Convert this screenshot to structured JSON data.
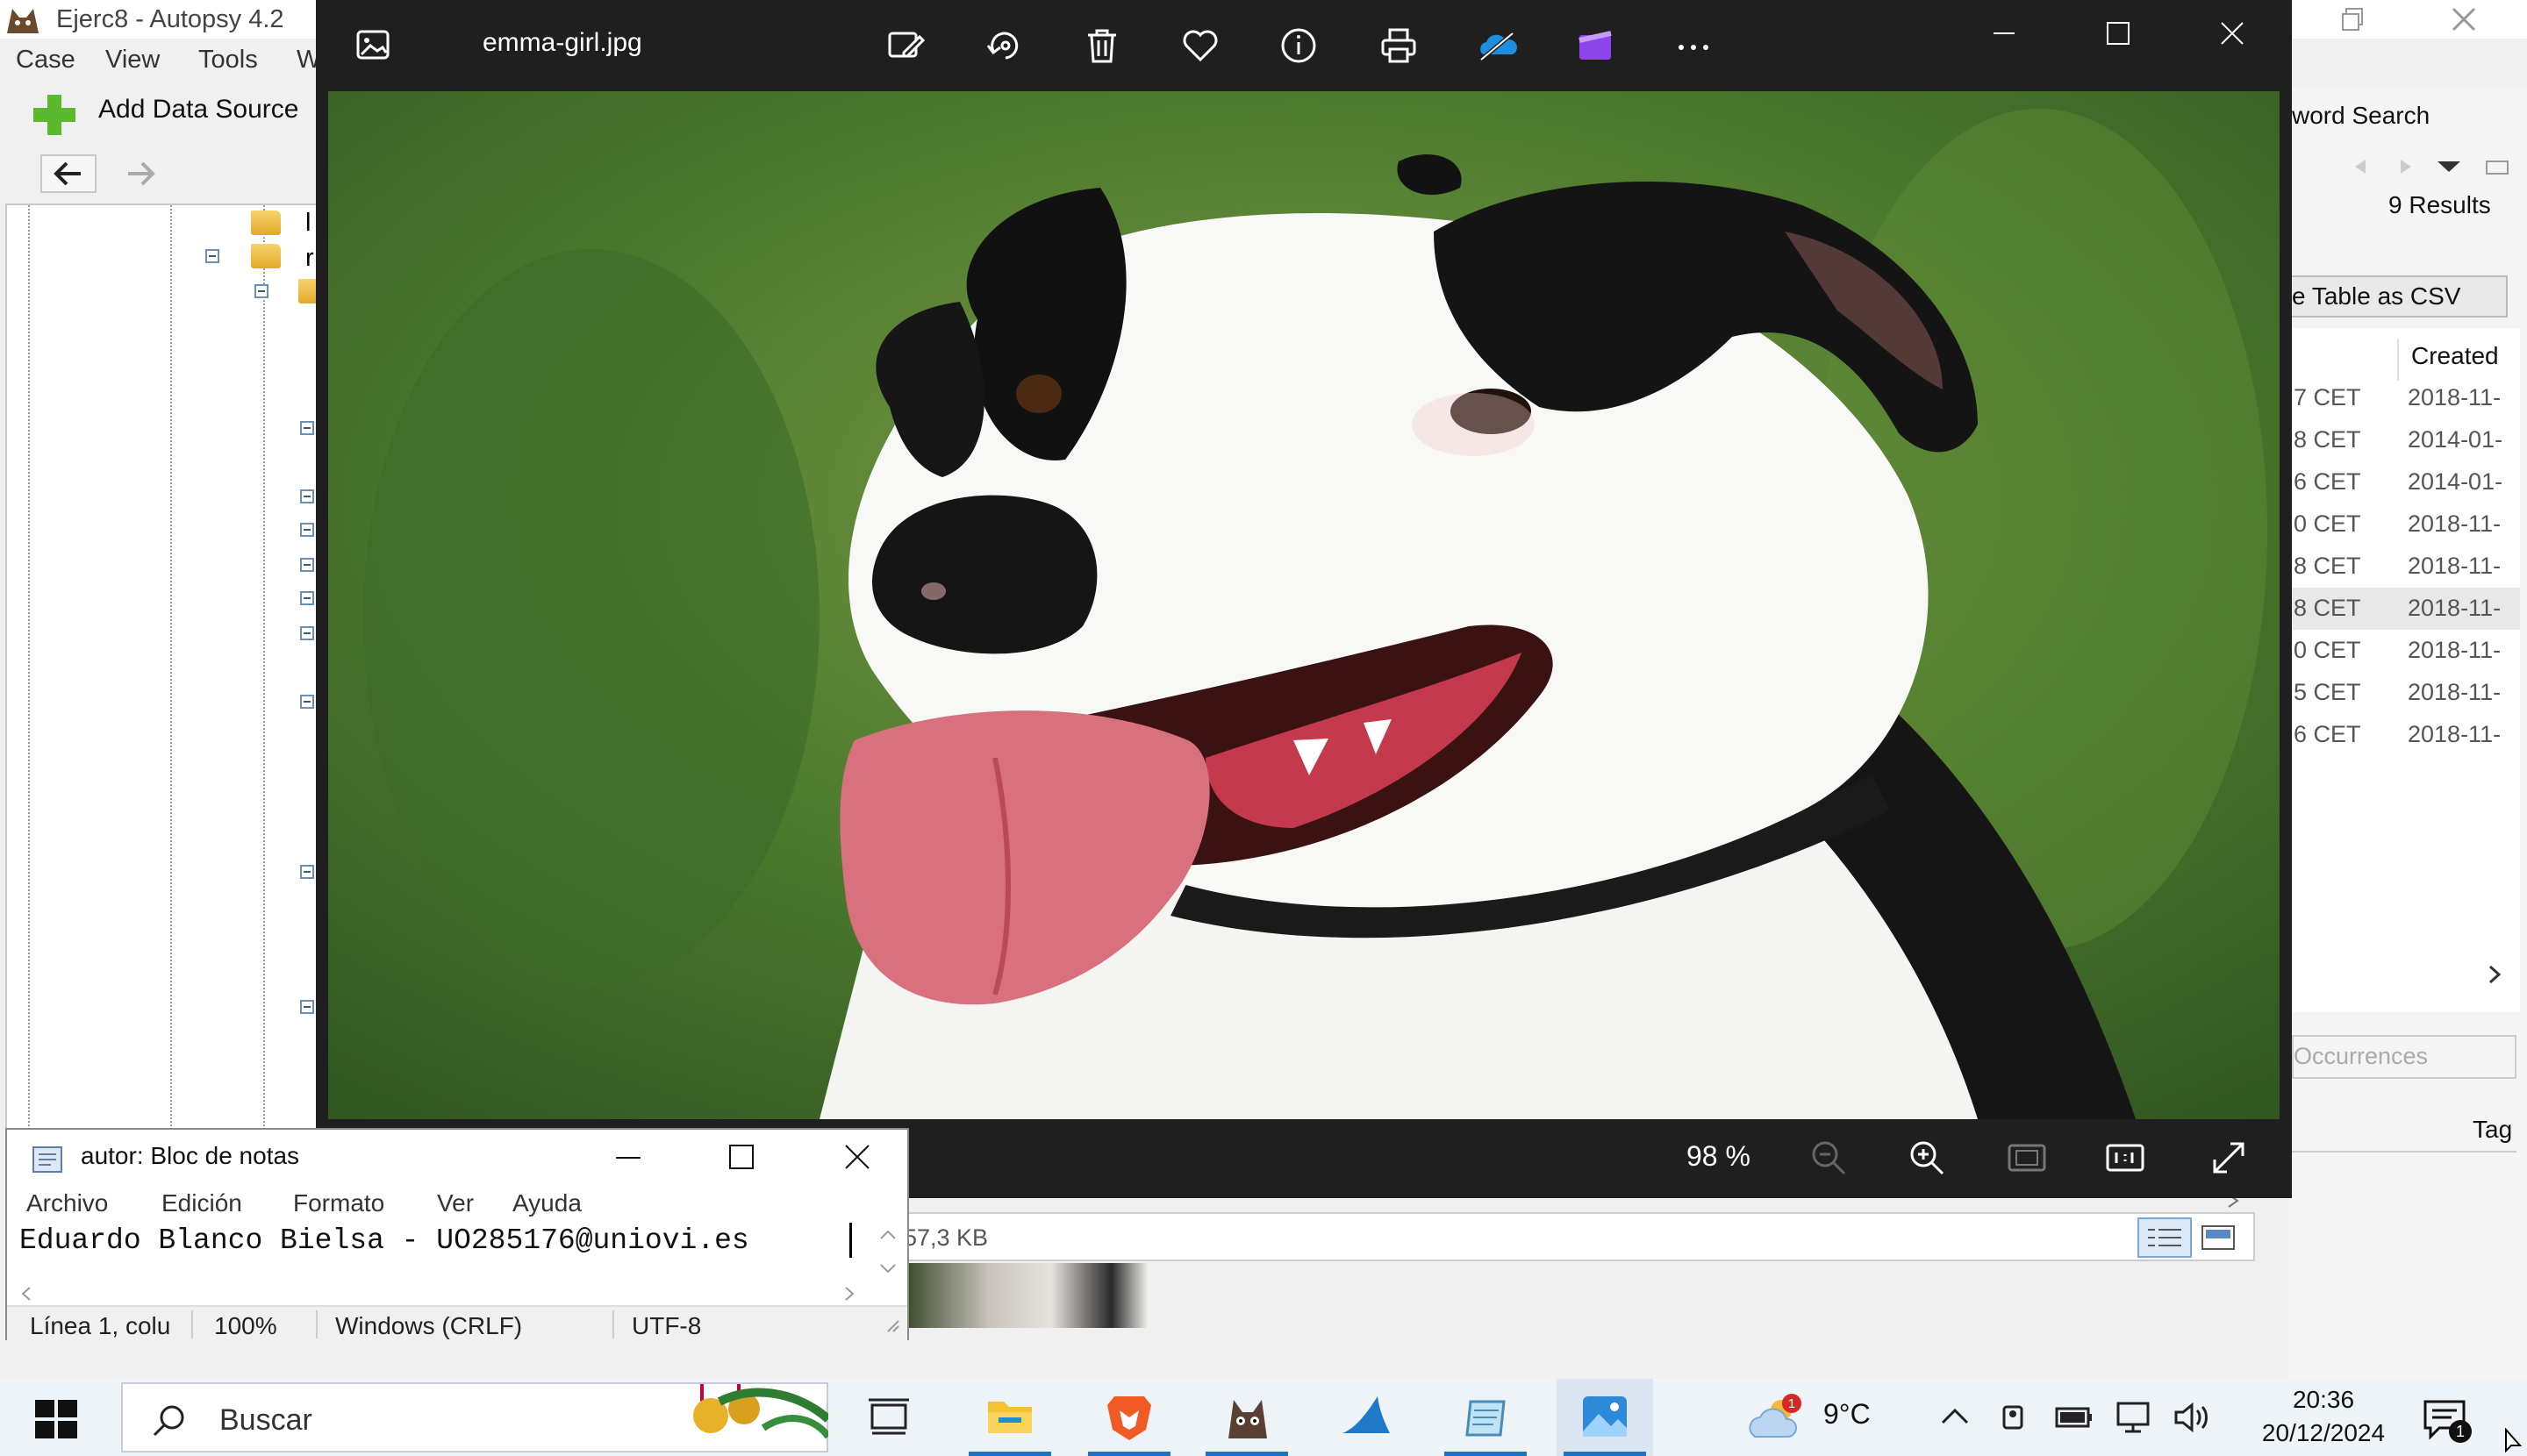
{
  "autopsy": {
    "title": "Ejerc8 - Autopsy 4.2",
    "menu": [
      "Case",
      "View",
      "Tools",
      "W"
    ],
    "add_data_source": "Add Data Source",
    "tree_items": [
      "l",
      "r"
    ],
    "keyword_search_label": "word Search",
    "results_count": "9  Results",
    "save_csv_label": "e Table as CSV",
    "created_header": "Created",
    "rows": [
      {
        "time": "7 CET",
        "created": "2018-11-"
      },
      {
        "time": "8 CET",
        "created": "2014-01-"
      },
      {
        "time": "6 CET",
        "created": "2014-01-"
      },
      {
        "time": "0 CET",
        "created": "2018-11-"
      },
      {
        "time": "8 CET",
        "created": "2018-11-"
      },
      {
        "time": "8 CET",
        "created": "2018-11-"
      },
      {
        "time": "0 CET",
        "created": "2018-11-"
      },
      {
        "time": "5 CET",
        "created": "2018-11-"
      },
      {
        "time": "6 CET",
        "created": "2018-11-"
      }
    ],
    "occurrences_label": "Occurrences",
    "tag_label": "Tag",
    "file_size": "57,3 KB"
  },
  "photos": {
    "title": "emma-girl.jpg",
    "zoom": "98 %",
    "toolbar_icons": [
      "edit-icon",
      "rotate-icon",
      "delete-icon",
      "heart-icon",
      "info-icon",
      "print-icon",
      "onedrive-icon",
      "video-editor-icon",
      "more-icon"
    ]
  },
  "notepad": {
    "title": "autor: Bloc de notas",
    "menu": [
      "Archivo",
      "Edición",
      "Formato",
      "Ver",
      "Ayuda"
    ],
    "text": "Eduardo Blanco Bielsa - UO285176@uniovi.es",
    "status": {
      "position": "Línea 1, colu",
      "zoom": "100%",
      "line_ending": "Windows (CRLF)",
      "encoding": "UTF-8"
    }
  },
  "taskbar": {
    "search_placeholder": "Buscar",
    "temperature": "9°C",
    "weather_badge": "1",
    "time": "20:36",
    "date": "20/12/2024",
    "notification_count": "1",
    "apps": [
      "task-view-icon",
      "file-explorer-icon",
      "brave-icon",
      "autopsy-icon",
      "wireshark-icon",
      "notepad-icon",
      "photos-icon"
    ]
  }
}
